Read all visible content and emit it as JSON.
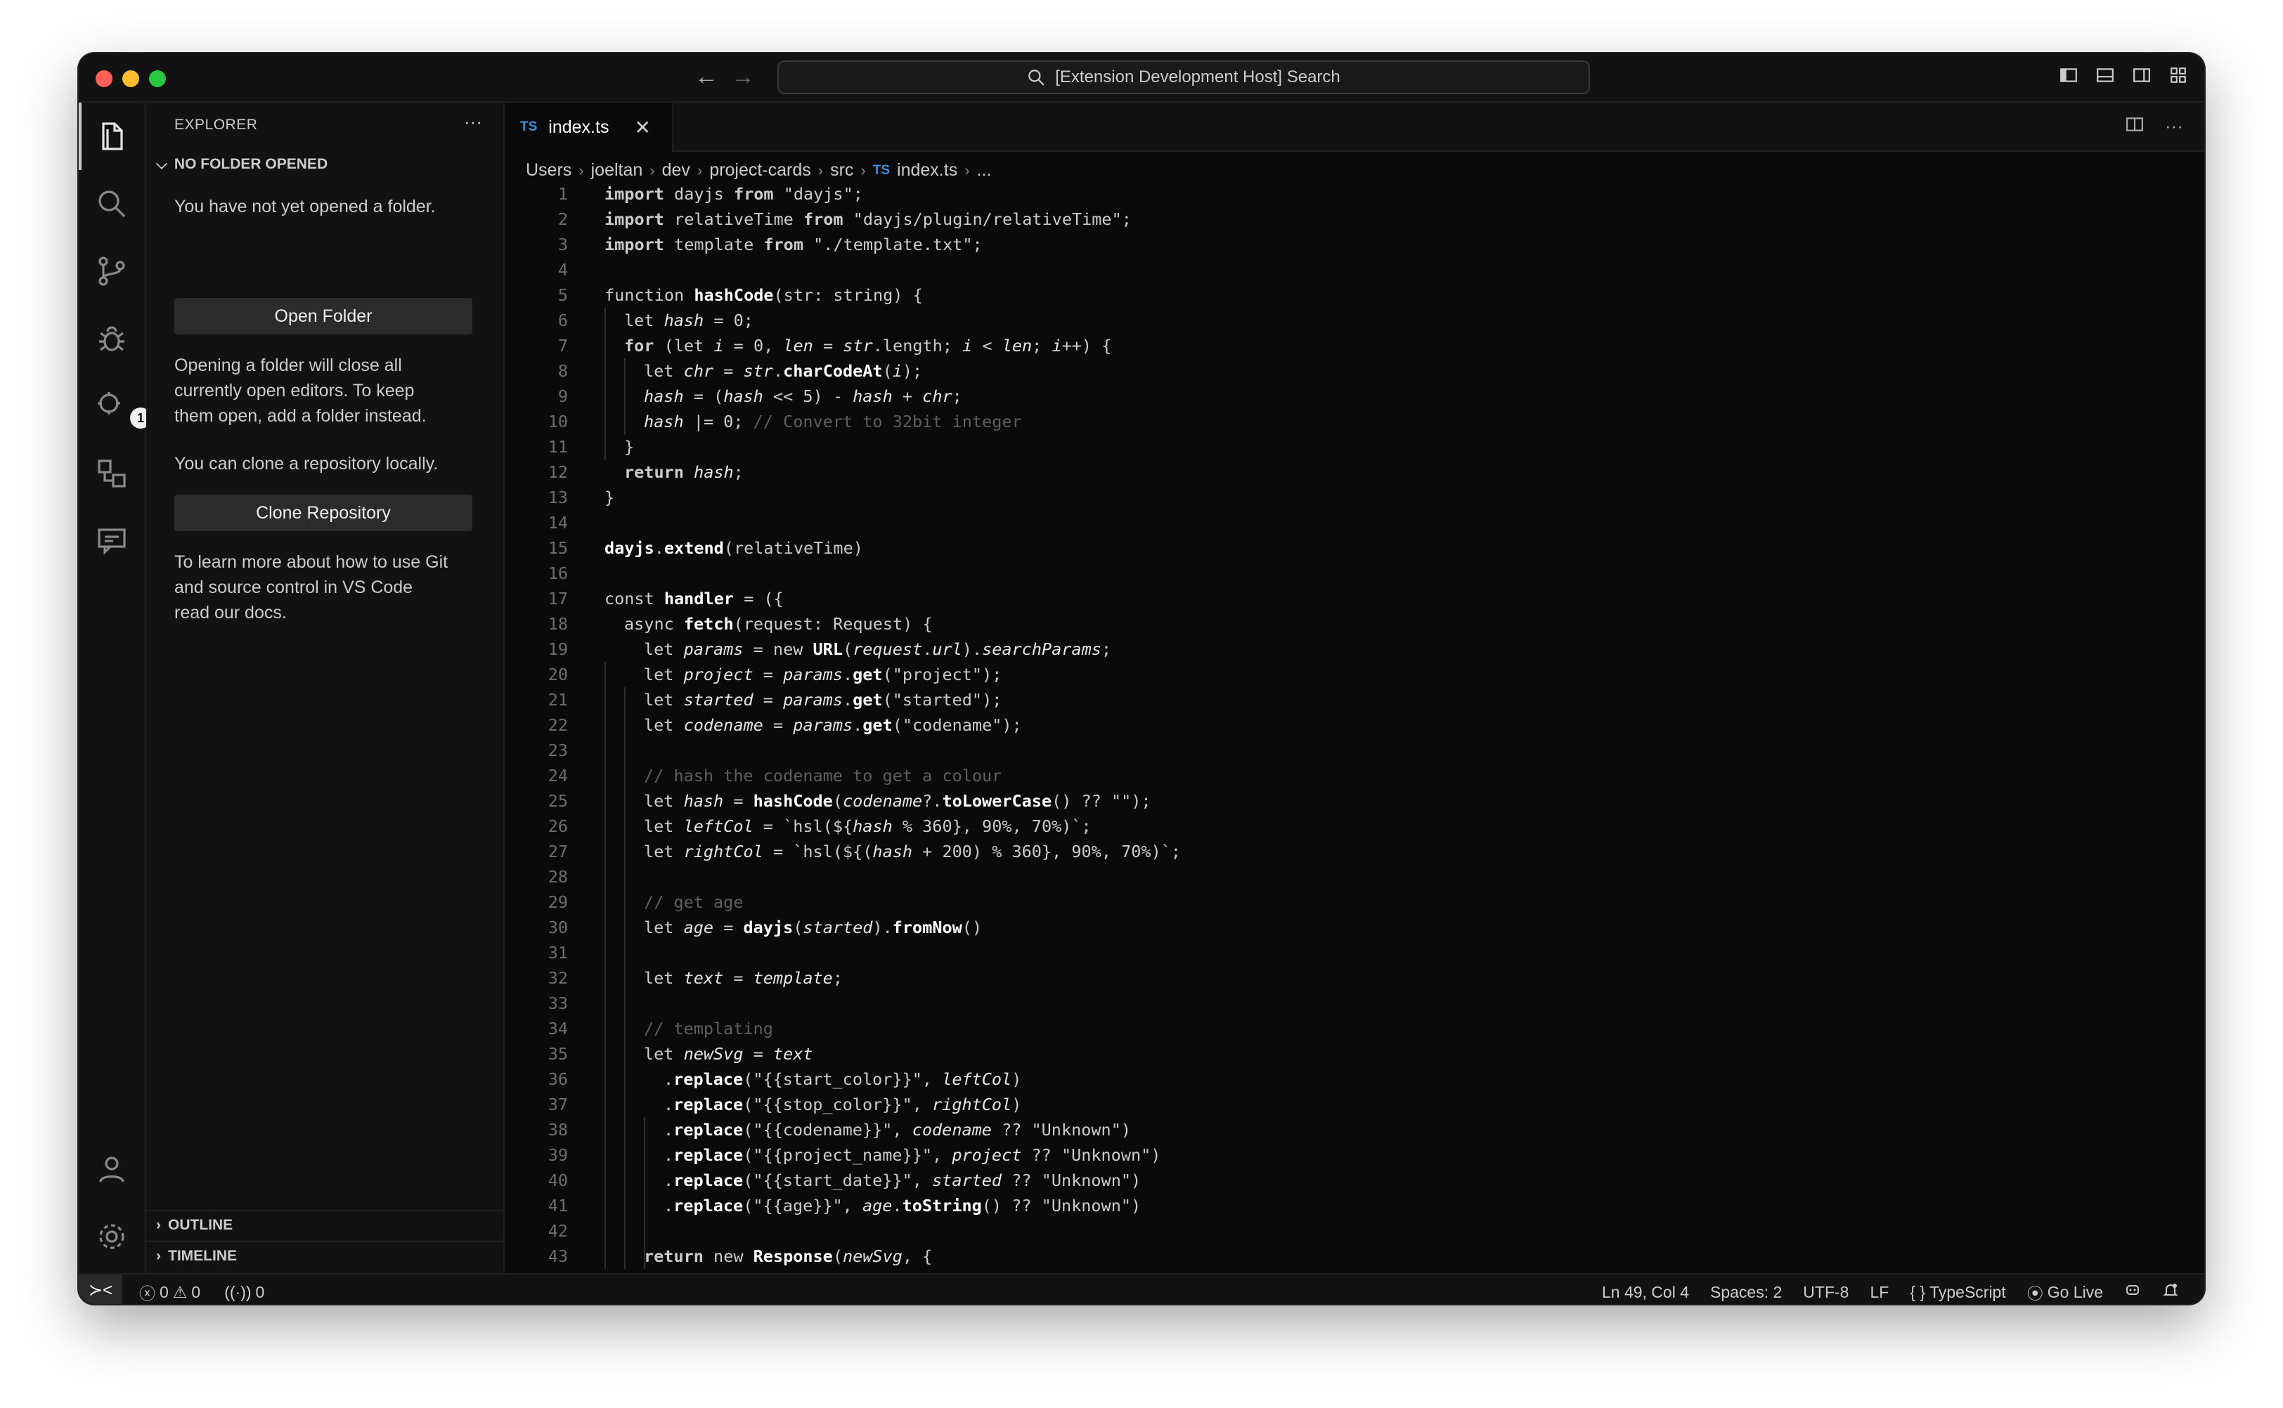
{
  "titlebar": {
    "search_text": "[Extension Development Host] Search"
  },
  "activity": {
    "extensions_badge": "1"
  },
  "sidebar": {
    "title": "EXPLORER",
    "more": "···",
    "section_header": "NO FOLDER OPENED",
    "msg_not_opened": "You have not yet opened a folder.",
    "open_folder_button": "Open Folder",
    "msg_close_editors_1": "Opening a folder will close all",
    "msg_close_editors_2": "currently open editors. To keep",
    "msg_close_editors_3": "them open, add a folder instead.",
    "msg_clone": "You can clone a repository locally.",
    "clone_button": "Clone Repository",
    "msg_learn_1": "To learn more about how to use Git",
    "msg_learn_2": "and source control in VS Code",
    "msg_learn_3": "read our docs.",
    "outline": "OUTLINE",
    "timeline": "TIMELINE"
  },
  "editor": {
    "tab": {
      "badge": "TS",
      "name": "index.ts",
      "close": "✕"
    },
    "actions_more": "···",
    "breadcrumb": [
      "Users",
      "joeltan",
      "dev",
      "project-cards",
      "src"
    ],
    "breadcrumb_file": "index.ts",
    "breadcrumb_badge": "TS",
    "breadcrumb_tail": "...",
    "line_numbers": [
      "1",
      "2",
      "3",
      "4",
      "5",
      "6",
      "7",
      "8",
      "9",
      "10",
      "11",
      "12",
      "13",
      "14",
      "15",
      "16",
      "17",
      "18",
      "19",
      "20",
      "21",
      "22",
      "23",
      "24",
      "25",
      "26",
      "27",
      "28",
      "29",
      "30",
      "31",
      "32",
      "33",
      "34",
      "35",
      "36",
      "37",
      "38",
      "39",
      "40",
      "41",
      "42",
      "43"
    ]
  },
  "code": {
    "l1": [
      "import ",
      "dayjs",
      " from ",
      "\"dayjs\"",
      ";"
    ],
    "l2": [
      "import ",
      "relativeTime",
      " from ",
      "\"dayjs/plugin/relativeTime\"",
      ";"
    ],
    "l3": [
      "import ",
      "template",
      " from ",
      "\"./template.txt\"",
      ";"
    ],
    "l5": [
      "function ",
      "hashCode",
      "(str: string) {"
    ],
    "l6": [
      "let ",
      "hash",
      " = 0;"
    ],
    "l7": [
      "for ",
      "(let ",
      "i",
      " = 0, ",
      "len",
      " = ",
      "str",
      ".length; ",
      "i",
      " < ",
      "len",
      "; ",
      "i",
      "++) {"
    ],
    "l8": [
      "let ",
      "chr",
      " = ",
      "str",
      ".",
      "charCodeAt",
      "(",
      "i",
      ");"
    ],
    "l9": [
      "hash",
      " = (",
      "hash",
      " << 5) - ",
      "hash",
      " + ",
      "chr",
      ";"
    ],
    "l10": [
      "hash",
      " |= 0; ",
      "// Convert to 32bit integer"
    ],
    "l11": [
      "}"
    ],
    "l12": [
      "return ",
      "hash",
      ";"
    ],
    "l13": [
      "}"
    ],
    "l15": [
      "dayjs",
      ".",
      "extend",
      "(relativeTime)"
    ],
    "l17": [
      "const ",
      "handler",
      " = ({"
    ],
    "l18": [
      "async ",
      "fetch",
      "(request: Request) {"
    ],
    "l19": [
      "let ",
      "params",
      " = new ",
      "URL",
      "(",
      "request",
      ".",
      "url",
      ").",
      "searchParams",
      ";"
    ],
    "l20": [
      "let ",
      "project",
      " = ",
      "params",
      ".",
      "get",
      "(\"project\");"
    ],
    "l21": [
      "let ",
      "started",
      " = ",
      "params",
      ".",
      "get",
      "(\"started\");"
    ],
    "l22": [
      "let ",
      "codename",
      " = ",
      "params",
      ".",
      "get",
      "(\"codename\");"
    ],
    "l24": [
      "// hash the codename to get a colour"
    ],
    "l25": [
      "let ",
      "hash",
      " = ",
      "hashCode",
      "(",
      "codename",
      "?.",
      "toLowerCase",
      "() ?? \"\");"
    ],
    "l26": [
      "let ",
      "leftCol",
      " = `hsl(${",
      "hash",
      " % 360}, 90%, 70%)`;"
    ],
    "l27": [
      "let ",
      "rightCol",
      " = `hsl(${(",
      "hash",
      " + 200) % 360}, 90%, 70%)`;"
    ],
    "l29": [
      "// get age"
    ],
    "l30": [
      "let ",
      "age",
      " = ",
      "dayjs",
      "(",
      "started",
      ").",
      "fromNow",
      "()"
    ],
    "l32": [
      "let ",
      "text",
      " = ",
      "template",
      ";"
    ],
    "l34": [
      "// templating"
    ],
    "l35": [
      "let ",
      "newSvg",
      " = ",
      "text"
    ],
    "l36": [
      ".",
      "replace",
      "(\"{{start_color}}\", ",
      "leftCol",
      ")"
    ],
    "l37": [
      ".",
      "replace",
      "(\"{{stop_color}}\", ",
      "rightCol",
      ")"
    ],
    "l38": [
      ".",
      "replace",
      "(\"{{codename}}\", ",
      "codename",
      " ?? \"Unknown\")"
    ],
    "l39": [
      ".",
      "replace",
      "(\"{{project_name}}\", ",
      "project",
      " ?? \"Unknown\")"
    ],
    "l40": [
      ".",
      "replace",
      "(\"{{start_date}}\", ",
      "started",
      " ?? \"Unknown\")"
    ],
    "l41": [
      ".",
      "replace",
      "(\"{{age}}\", ",
      "age",
      ".",
      "toString",
      "() ?? \"Unknown\")"
    ],
    "l43": [
      "return ",
      "new ",
      "Response",
      "(",
      "newSvg",
      ", {"
    ]
  },
  "status": {
    "errors": "0",
    "warnings": "0",
    "ports": "0",
    "position": "Ln 49, Col 4",
    "spaces": "Spaces: 2",
    "encoding": "UTF-8",
    "eol": "LF",
    "language_braces": "{ }",
    "language": "TypeScript",
    "go_live": "Go Live"
  }
}
